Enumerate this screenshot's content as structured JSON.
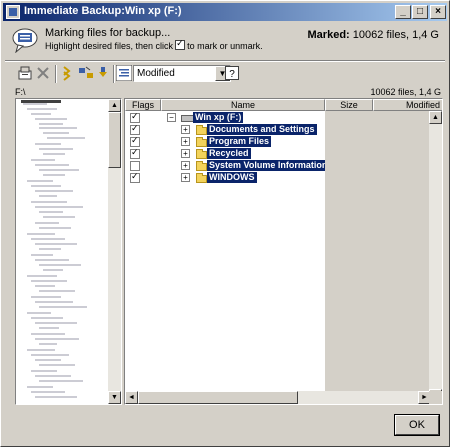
{
  "window": {
    "title": "Immediate Backup:Win xp (F:)",
    "buttons": {
      "minimize": "_",
      "maximize": "□",
      "close": "×"
    }
  },
  "header": {
    "message": "Marking files for backup...",
    "hint_before": "Highlight desired files, then click",
    "hint_after": "to mark or unmark.",
    "marked_label": "Marked:",
    "marked_value": "10062 files, 1,4 G"
  },
  "toolbar": {
    "tools": [
      "properties-icon",
      "delete-icon",
      "select-icon",
      "refresh-icon",
      "down-icon",
      "filter-icon",
      "help-icon"
    ],
    "filter_value": "Modified"
  },
  "pathbar": {
    "path": "F:\\",
    "summary": "10062 files, 1,4 G"
  },
  "columns": [
    "Flags",
    "Name",
    "Size",
    "Modified"
  ],
  "tree": {
    "root": {
      "label": "Win xp (F:)",
      "expander": "⊟",
      "checked": true
    },
    "items": [
      {
        "label": "Documents and Settings",
        "checked": true,
        "expander": "+"
      },
      {
        "label": "Program Files",
        "checked": true,
        "expander": "+"
      },
      {
        "label": "Recycled",
        "checked": true,
        "expander": "+"
      },
      {
        "label": "System Volume Information",
        "checked": false,
        "expander": "+"
      },
      {
        "label": "WINDOWS",
        "checked": true,
        "expander": "+"
      }
    ]
  },
  "scroll": {
    "up": "▲",
    "down": "▼",
    "left": "◄",
    "right": "►"
  },
  "ok_button": {
    "label": "OK"
  },
  "colors": {
    "selection": "#0a246a",
    "face": "#d4d0c8",
    "title_start": "#0a246a",
    "title_end": "#a6caf0"
  }
}
